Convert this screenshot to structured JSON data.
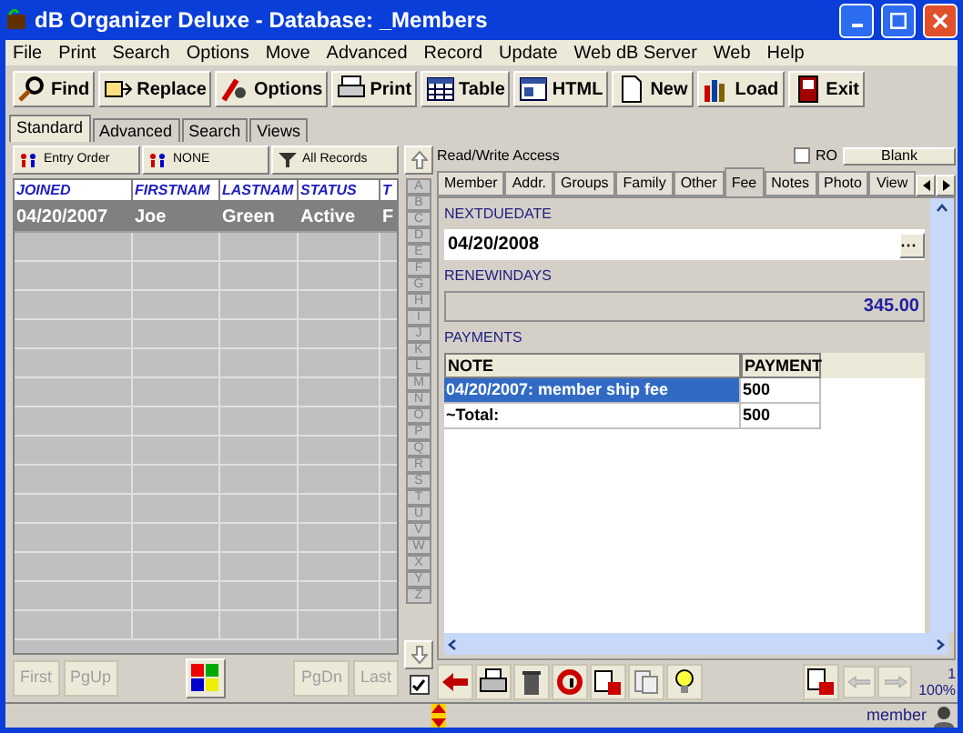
{
  "window": {
    "title": "dB Organizer Deluxe - Database: _Members"
  },
  "menu": [
    "File",
    "Print",
    "Search",
    "Options",
    "Move",
    "Advanced",
    "Record",
    "Update",
    "Web dB Server",
    "Web",
    "Help"
  ],
  "toolbar": [
    "Find",
    "Replace",
    "Options",
    "Print",
    "Table",
    "HTML",
    "New",
    "Load",
    "Exit"
  ],
  "view_tabs": [
    {
      "label": "Standard",
      "selected": true
    },
    {
      "label": "Advanced",
      "selected": false
    },
    {
      "label": "Search",
      "selected": false
    },
    {
      "label": "Views",
      "selected": false
    }
  ],
  "sort_bar": [
    "Entry Order",
    "NONE",
    "All Records"
  ],
  "grid": {
    "columns": [
      "JOINED",
      "FIRSTNAM",
      "LASTNAM",
      "STATUS",
      "T"
    ],
    "rows": [
      {
        "cells": [
          "04/20/2007",
          "Joe",
          "Green",
          "Active",
          "F"
        ],
        "selected": true
      }
    ]
  },
  "letters": [
    "A",
    "B",
    "C",
    "D",
    "E",
    "F",
    "G",
    "H",
    "I",
    "J",
    "K",
    "L",
    "M",
    "N",
    "O",
    "P",
    "Q",
    "R",
    "S",
    "T",
    "U",
    "V",
    "W",
    "X",
    "Y",
    "Z"
  ],
  "nav_buttons": [
    {
      "label": "First",
      "disabled": true
    },
    {
      "label": "PgUp",
      "disabled": true
    },
    {
      "label": "PgDn",
      "disabled": true
    },
    {
      "label": "Last",
      "disabled": true
    }
  ],
  "filter_checkbox": {
    "checked": true
  },
  "record": {
    "access": "Read/Write Access",
    "ro": {
      "label": "RO",
      "checked": false
    },
    "blank_button": "Blank",
    "tabs": [
      {
        "label": "Member",
        "selected": false
      },
      {
        "label": "Addr.",
        "selected": false
      },
      {
        "label": "Groups",
        "selected": false
      },
      {
        "label": "Family",
        "selected": false
      },
      {
        "label": "Other",
        "selected": false
      },
      {
        "label": "Fee",
        "selected": true
      },
      {
        "label": "Notes",
        "selected": false
      },
      {
        "label": "Photo",
        "selected": false
      },
      {
        "label": "View",
        "selected": false
      }
    ],
    "fields": [
      {
        "label": "NEXTDUEDATE",
        "kind": "date",
        "value": "04/20/2008"
      },
      {
        "label": "RENEWINDAYS",
        "kind": "number",
        "value": "345.00"
      }
    ],
    "payments": {
      "label": "PAYMENTS",
      "columns": [
        "NOTE",
        "PAYMENT"
      ],
      "rows": [
        {
          "cells": [
            "04/20/2007: member ship fee",
            "500"
          ],
          "selected": true
        },
        {
          "cells": [
            "~Total:",
            "500"
          ],
          "selected": false
        }
      ]
    }
  },
  "record_count": "1",
  "zoom": "100%",
  "status_bar": {
    "user": "member"
  }
}
